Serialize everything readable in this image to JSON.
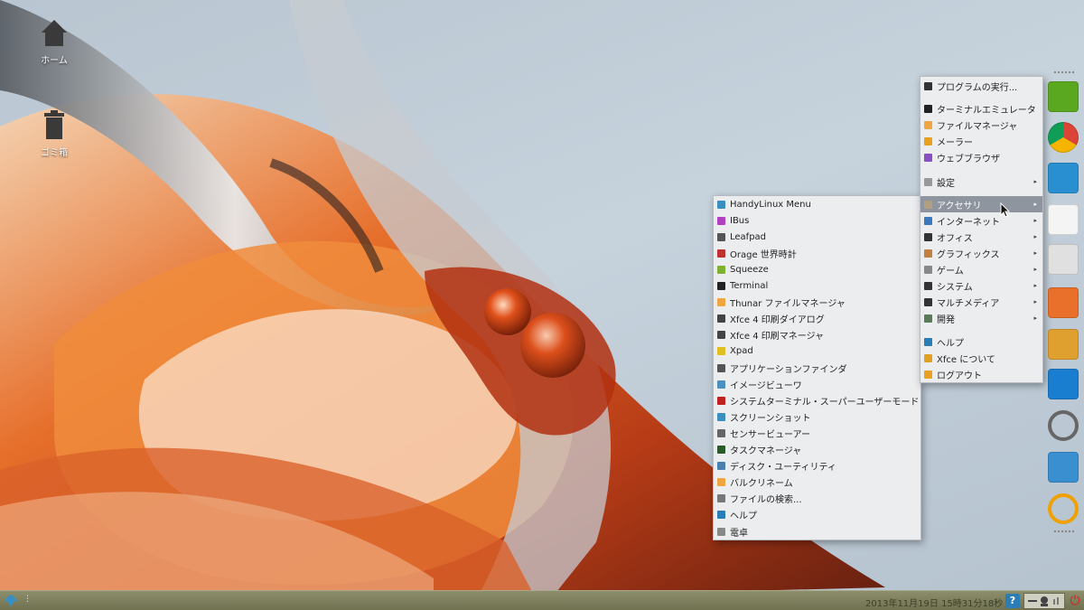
{
  "desktop": {
    "icons": [
      {
        "label": "ホーム",
        "icon": "home-icon"
      },
      {
        "label": "ゴミ箱",
        "icon": "trash-icon"
      }
    ]
  },
  "main_menu": {
    "items": [
      {
        "label": "プログラムの実行...",
        "icon": "run-icon",
        "color": "#333333"
      },
      {
        "label": "ターミナルエミュレータ",
        "icon": "terminal-icon",
        "color": "#222222"
      },
      {
        "label": "ファイルマネージャ",
        "icon": "folder-icon",
        "color": "#f0a640"
      },
      {
        "label": "メーラー",
        "icon": "mail-icon",
        "color": "#e8a020"
      },
      {
        "label": "ウェブブラウザ",
        "icon": "browser-icon",
        "color": "#8a4fc0"
      },
      {
        "label": "設定",
        "icon": "settings-icon",
        "color": "#999999",
        "submenu": true
      },
      {
        "label": "アクセサリ",
        "icon": "accessories-icon",
        "color": "#b0a080",
        "submenu": true,
        "highlighted": true
      },
      {
        "label": "インターネット",
        "icon": "internet-icon",
        "color": "#3a78c0",
        "submenu": true
      },
      {
        "label": "オフィス",
        "icon": "office-icon",
        "color": "#333333",
        "submenu": true
      },
      {
        "label": "グラフィックス",
        "icon": "graphics-icon",
        "color": "#c08040",
        "submenu": true
      },
      {
        "label": "ゲーム",
        "icon": "games-icon",
        "color": "#888888",
        "submenu": true
      },
      {
        "label": "システム",
        "icon": "system-icon",
        "color": "#333333",
        "submenu": true
      },
      {
        "label": "マルチメディア",
        "icon": "multimedia-icon",
        "color": "#333333",
        "submenu": true
      },
      {
        "label": "開発",
        "icon": "development-icon",
        "color": "#5a7a5a",
        "submenu": true
      },
      {
        "label": "ヘルプ",
        "icon": "help-icon",
        "color": "#2a7db5"
      },
      {
        "label": "Xfce について",
        "icon": "info-icon",
        "color": "#e0a020"
      },
      {
        "label": "ログアウト",
        "icon": "logout-icon",
        "color": "#e8a020"
      }
    ]
  },
  "accessories_menu": {
    "items": [
      {
        "label": "HandyLinux Menu",
        "icon": "handylinux-icon",
        "color": "#3a8fc0"
      },
      {
        "label": "IBus",
        "icon": "ibus-icon",
        "color": "#b040c0"
      },
      {
        "label": "Leafpad",
        "icon": "leafpad-icon",
        "color": "#555555"
      },
      {
        "label": "Orage 世界時計",
        "icon": "clock-icon",
        "color": "#c03030"
      },
      {
        "label": "Squeeze",
        "icon": "squeeze-icon",
        "color": "#80b030"
      },
      {
        "label": "Terminal",
        "icon": "terminal-icon",
        "color": "#222222"
      },
      {
        "label": "Thunar ファイルマネージャ",
        "icon": "folder-icon",
        "color": "#f0a640"
      },
      {
        "label": "Xfce 4 印刷ダイアログ",
        "icon": "printer-icon",
        "color": "#444444"
      },
      {
        "label": "Xfce 4 印刷マネージャ",
        "icon": "printer-icon",
        "color": "#444444"
      },
      {
        "label": "Xpad",
        "icon": "xpad-icon",
        "color": "#e0c020"
      },
      {
        "label": "アプリケーションファインダ",
        "icon": "search-icon",
        "color": "#555555"
      },
      {
        "label": "イメージビューワ",
        "icon": "image-viewer-icon",
        "color": "#4a90c0"
      },
      {
        "label": "システムターミナル・スーパーユーザーモード",
        "icon": "root-terminal-icon",
        "color": "#c02020"
      },
      {
        "label": "スクリーンショット",
        "icon": "screenshot-icon",
        "color": "#3a8fc0"
      },
      {
        "label": "センサービューアー",
        "icon": "sensor-icon",
        "color": "#666666"
      },
      {
        "label": "タスクマネージャ",
        "icon": "task-manager-icon",
        "color": "#2a5a2a"
      },
      {
        "label": "ディスク・ユーティリティ",
        "icon": "disk-icon",
        "color": "#4a80b0"
      },
      {
        "label": "バルクリネーム",
        "icon": "bulk-rename-icon",
        "color": "#f0a640"
      },
      {
        "label": "ファイルの検索...",
        "icon": "search-icon",
        "color": "#777777"
      },
      {
        "label": "ヘルプ",
        "icon": "help-icon",
        "color": "#2a7db5"
      },
      {
        "label": "電卓",
        "icon": "calculator-icon",
        "color": "#888888"
      }
    ]
  },
  "dock": {
    "items": [
      {
        "icon": "play-launcher-icon",
        "color": "#5aa820"
      },
      {
        "icon": "chrome-icon",
        "color": "#ffffff"
      },
      {
        "icon": "fan-icon",
        "color": "#2a8fd0"
      },
      {
        "icon": "notes-icon",
        "color": "#f4f4f4"
      },
      {
        "icon": "toggle-icon",
        "color": "#e0e0e0"
      },
      {
        "icon": "software-center-icon",
        "color": "#e8702a"
      },
      {
        "icon": "download-icon",
        "color": "#e0a030"
      },
      {
        "icon": "teamviewer-icon",
        "color": "#1a7ed0"
      },
      {
        "icon": "volume-icon",
        "color": "#666666"
      },
      {
        "icon": "window-icon",
        "color": "#3a8fd0"
      },
      {
        "icon": "logout-dock-icon",
        "color": "#f0a000"
      }
    ]
  },
  "panel": {
    "clock": "2013年11月19日 15時31分18秒",
    "help_label": "?",
    "power_symbol": "⏻"
  }
}
